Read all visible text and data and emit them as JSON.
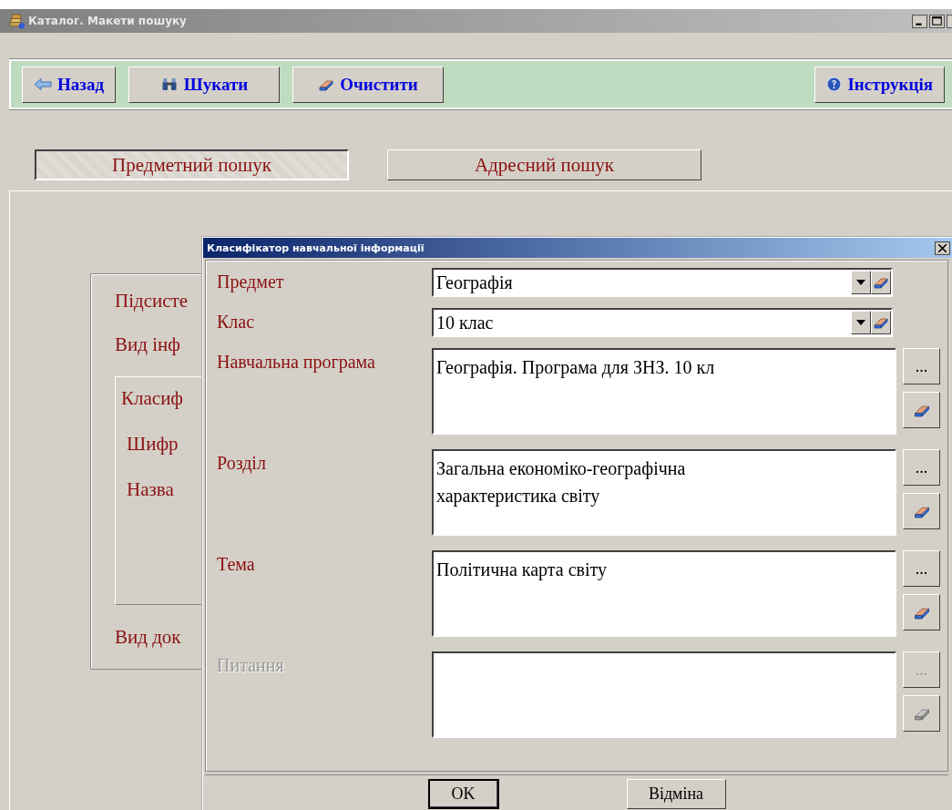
{
  "window": {
    "title": "Каталог. Макети пошуку"
  },
  "toolbar": {
    "buttons": [
      {
        "label": "Назад",
        "kind": "back"
      },
      {
        "label": "Шукати",
        "kind": "search"
      },
      {
        "label": "Очистити",
        "kind": "clear"
      }
    ],
    "help_button": {
      "label": "Інструкція"
    }
  },
  "tabs": [
    {
      "label": "Предметний пошук",
      "selected": true
    },
    {
      "label": "Адресний пошук",
      "selected": false
    }
  ],
  "background_form": {
    "labels_top": [
      "Підсисте",
      "Вид інф"
    ],
    "group": {
      "title": "Класиф",
      "fields": [
        "Шифр",
        "Назва"
      ]
    },
    "labels_bottom": [
      "Вид док"
    ]
  },
  "dialog": {
    "title": "Класифікатор навчальної інформації",
    "fields": [
      {
        "label": "Предмет",
        "kind": "combo",
        "value": "Географія",
        "disabled": false
      },
      {
        "label": "Клас",
        "kind": "combo",
        "value": "10 клас",
        "disabled": false
      },
      {
        "label": "Навчальна програма",
        "kind": "memo",
        "value": "Географія. Програма для ЗНЗ. 10 кл",
        "browse_label": "...",
        "disabled": false
      },
      {
        "label": "Розділ",
        "kind": "memo",
        "value": "Загальна економіко-географічна характеристика світу",
        "browse_label": "...",
        "disabled": false
      },
      {
        "label": "Тема",
        "kind": "memo",
        "value": "Політична карта світу",
        "browse_label": "...",
        "disabled": false
      },
      {
        "label": "Питання",
        "kind": "memo",
        "browse_label": "...",
        "disabled": true
      }
    ],
    "buttons": [
      {
        "label": "OK",
        "default": true
      },
      {
        "label": "Відміна",
        "default": false
      }
    ]
  }
}
